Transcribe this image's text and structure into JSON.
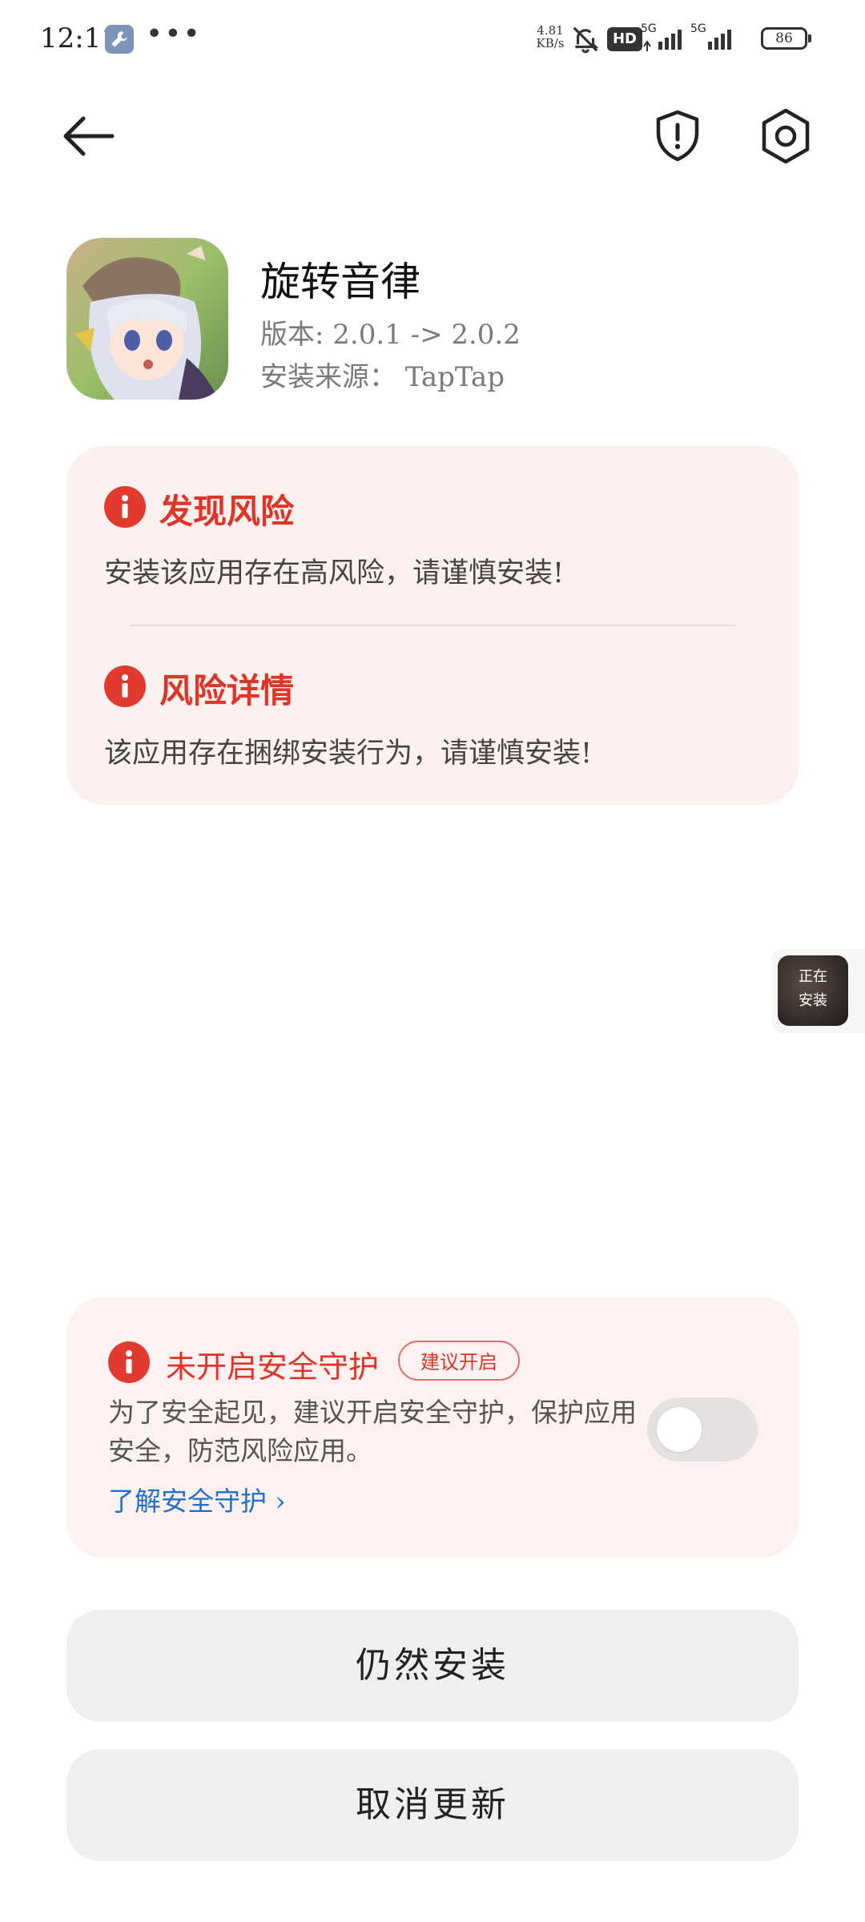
{
  "status_bar": {
    "time": "12:11",
    "speed_value": "4.81",
    "speed_unit": "KB/s",
    "hd_label": "HD",
    "signal1_label": "5G",
    "signal2_label": "5G",
    "battery": "86",
    "overflow": "•••",
    "icons": [
      "wrench-icon",
      "bell-muted-icon",
      "hd-voice-icon",
      "signal-icon",
      "signal-icon",
      "battery-icon"
    ]
  },
  "header": {
    "back_icon": "back-arrow-icon",
    "shield_icon": "shield-alert-icon",
    "settings_icon": "settings-hexagon-icon"
  },
  "app": {
    "name": "旋转音律",
    "version": "版本: 2.0.1 -> 2.0.2",
    "source": "安装来源： TapTap"
  },
  "risk_card": {
    "found_title": "发现风险",
    "found_desc": "安装该应用存在高风险，请谨慎安装!",
    "detail_title": "风险详情",
    "detail_desc": "该应用存在捆绑安装行为，请谨慎安装!",
    "accent": "#e23a2e"
  },
  "floating_install": {
    "line1": "正在",
    "line2": "安装"
  },
  "protection": {
    "title": "未开启安全守护",
    "badge": "建议开启",
    "desc": "为了安全起见，建议开启安全守护，保护应用安全，防范风险应用。",
    "link": "了解安全守护",
    "link_chevron": "›",
    "toggle_on": false,
    "link_color": "#1d6fd0"
  },
  "buttons": {
    "install_anyway": "仍然安装",
    "cancel_update": "取消更新"
  }
}
